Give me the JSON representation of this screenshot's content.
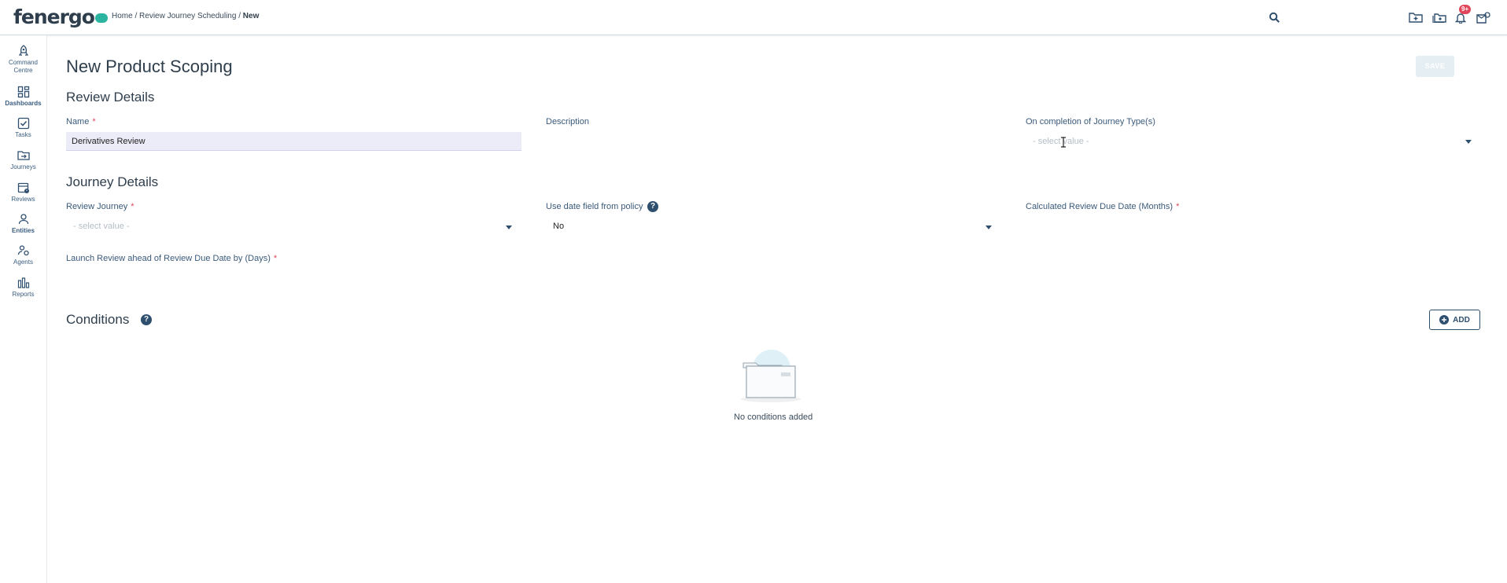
{
  "header": {
    "logo": "fenergo",
    "breadcrumb": {
      "home": "Home",
      "sep1": " / ",
      "parent": "Review Journey Scheduling",
      "sep2": " / ",
      "current": "New"
    },
    "notification_badge": "9+",
    "icons": [
      "search-icon",
      "folder-add-icon",
      "folder-stack-icon",
      "bell-icon",
      "mailbox-icon"
    ]
  },
  "sidebar": {
    "items": [
      {
        "label_line1": "Command",
        "label_line2": "Centre",
        "icon": "rocket-icon"
      },
      {
        "label_line1": "Dashboards",
        "label_line2": "",
        "icon": "dashboard-icon"
      },
      {
        "label_line1": "Tasks",
        "label_line2": "",
        "icon": "checkbox-icon"
      },
      {
        "label_line1": "Journeys",
        "label_line2": "",
        "icon": "folder-arrow-icon"
      },
      {
        "label_line1": "Reviews",
        "label_line2": "",
        "icon": "calendar-clock-icon"
      },
      {
        "label_line1": "Entities",
        "label_line2": "",
        "icon": "person-icon"
      },
      {
        "label_line1": "Agents",
        "label_line2": "",
        "icon": "agents-icon"
      },
      {
        "label_line1": "Reports",
        "label_line2": "",
        "icon": "bar-chart-icon"
      }
    ]
  },
  "page": {
    "title": "New Product Scoping",
    "save_label": "SAVE"
  },
  "review_details": {
    "title": "Review Details",
    "name_label": "Name",
    "name_value": "Derivatives Review",
    "description_label": "Description",
    "description_value": "",
    "completion_label": "On completion of Journey Type(s)",
    "completion_placeholder": "- select value -"
  },
  "journey_details": {
    "title": "Journey Details",
    "review_journey_label": "Review Journey",
    "review_journey_placeholder": "- select value -",
    "use_date_label": "Use date field from policy",
    "use_date_value": "No",
    "calculated_label": "Calculated Review Due Date (Months)",
    "launch_label": "Launch Review ahead of Review Due Date by (Days)"
  },
  "conditions": {
    "title": "Conditions",
    "add_label": "ADD",
    "empty_text": "No conditions added"
  },
  "required_marker": "*"
}
